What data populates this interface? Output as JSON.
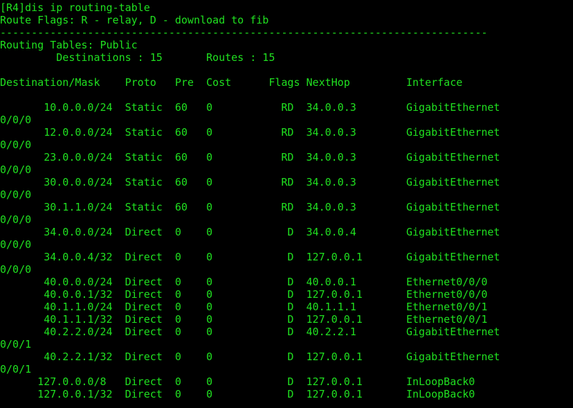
{
  "terminal": {
    "text_color": "#20e020",
    "background_color": "#000000",
    "lines": [
      "[R4]dis ip routing-table",
      "Route Flags: R - relay, D - download to fib",
      "------------------------------------------------------------------------------",
      "Routing Tables: Public",
      "         Destinations : 15       Routes : 15",
      "",
      "Destination/Mask    Proto   Pre  Cost      Flags NextHop         Interface",
      "",
      "       10.0.0.0/24  Static  60   0           RD  34.0.0.3        GigabitEthernet",
      "0/0/0",
      "       12.0.0.0/24  Static  60   0           RD  34.0.0.3        GigabitEthernet",
      "0/0/0",
      "       23.0.0.0/24  Static  60   0           RD  34.0.0.3        GigabitEthernet",
      "0/0/0",
      "       30.0.0.0/24  Static  60   0           RD  34.0.0.3        GigabitEthernet",
      "0/0/0",
      "       30.1.1.0/24  Static  60   0           RD  34.0.0.3        GigabitEthernet",
      "0/0/0",
      "       34.0.0.0/24  Direct  0    0            D  34.0.0.4        GigabitEthernet",
      "0/0/0",
      "       34.0.0.4/32  Direct  0    0            D  127.0.0.1       GigabitEthernet",
      "0/0/0",
      "       40.0.0.0/24  Direct  0    0            D  40.0.0.1        Ethernet0/0/0",
      "       40.0.0.1/32  Direct  0    0            D  127.0.0.1       Ethernet0/0/0",
      "       40.1.1.0/24  Direct  0    0            D  40.1.1.1        Ethernet0/0/1",
      "       40.1.1.1/32  Direct  0    0            D  127.0.0.1       Ethernet0/0/1",
      "       40.2.2.0/24  Direct  0    0            D  40.2.2.1        GigabitEthernet",
      "0/0/1",
      "       40.2.2.1/32  Direct  0    0            D  127.0.0.1       GigabitEthernet",
      "0/0/1",
      "      127.0.0.0/8   Direct  0    0            D  127.0.0.1       InLoopBack0",
      "      127.0.0.1/32  Direct  0    0            D  127.0.0.1       InLoopBack0"
    ]
  }
}
